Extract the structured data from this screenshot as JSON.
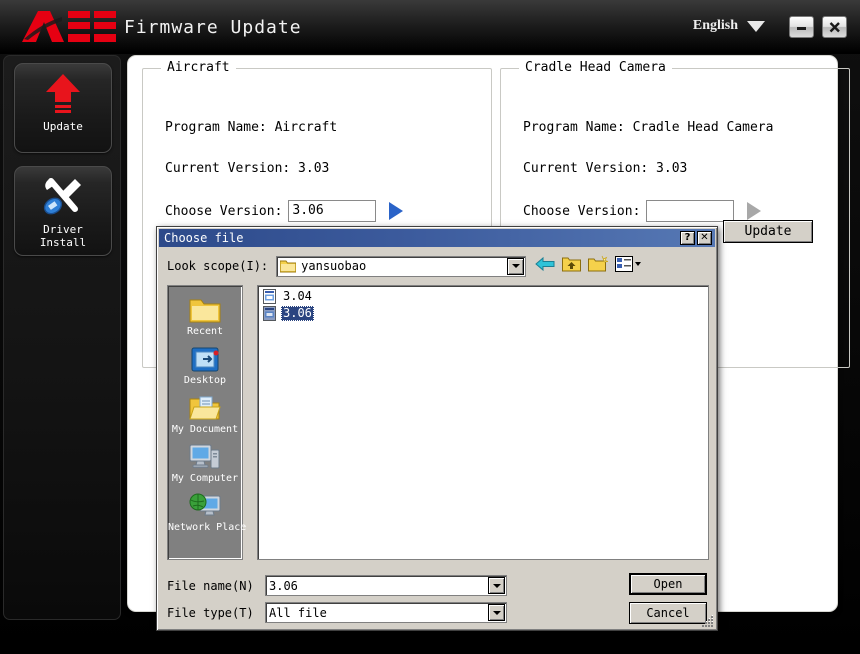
{
  "app": {
    "logo_text": "AEE",
    "title": "Firmware Update",
    "language": "English",
    "minimize_icon": "minimize-icon",
    "close_icon": "close-icon",
    "caret_icon": "chevron-down-icon"
  },
  "sidebar": {
    "items": [
      {
        "label": "Update",
        "icon": "upload-arrow-icon"
      },
      {
        "label": "Driver\nInstall",
        "label_line1": "Driver",
        "label_line2": "Install",
        "icon": "wrench-screwdriver-icon"
      }
    ]
  },
  "main": {
    "groups": [
      {
        "title": "Aircraft",
        "program_name_label": "Program Name: Aircraft",
        "current_version_label": "Current Version: 3.03",
        "choose_version_label": "Choose Version:",
        "choose_version_value": "3.06",
        "browse_icon": "play-triangle-icon",
        "browse_enabled": true
      },
      {
        "title": "Cradle Head Camera",
        "program_name_label": "Program Name: Cradle Head Camera",
        "current_version_label": "Current Version: 3.03",
        "choose_version_label": "Choose Version:",
        "choose_version_value": "",
        "browse_icon": "play-triangle-icon",
        "browse_enabled": false
      }
    ],
    "update_button_label": "Update"
  },
  "dialog": {
    "title": "Choose file",
    "help_button": "?",
    "close_button": "✕",
    "look_scope_label": "Look scope(I):",
    "look_scope_value": "yansuobao",
    "look_scope_icon": "folder-icon",
    "toolbar": [
      {
        "name": "back-icon"
      },
      {
        "name": "up-folder-icon"
      },
      {
        "name": "new-folder-icon"
      },
      {
        "name": "views-icon"
      }
    ],
    "places": [
      {
        "label": "Recent",
        "icon": "recent-folder-icon"
      },
      {
        "label": "Desktop",
        "icon": "desktop-icon"
      },
      {
        "label": "My Document",
        "icon": "my-documents-icon"
      },
      {
        "label": "My Computer",
        "icon": "my-computer-icon"
      },
      {
        "label": "Network Place",
        "icon": "network-place-icon"
      }
    ],
    "files": [
      {
        "name": "3.04",
        "icon": "application-file-icon",
        "selected": false
      },
      {
        "name": "3.06",
        "icon": "application-file-icon",
        "selected": true
      }
    ],
    "file_name_label": "File name(N)",
    "file_name_value": "3.06",
    "file_type_label": "File type(T)",
    "file_type_value": "All file",
    "open_button_label": "Open",
    "cancel_button_label": "Cancel",
    "resize_grip_icon": "resize-grip-icon"
  },
  "colors": {
    "logo_red": "#e60012",
    "accent_blue": "#2a63c8",
    "dialog_title_blue": "#3c5b9d",
    "selection_blue": "#2a4480",
    "dialog_face": "#d4d0c8"
  }
}
